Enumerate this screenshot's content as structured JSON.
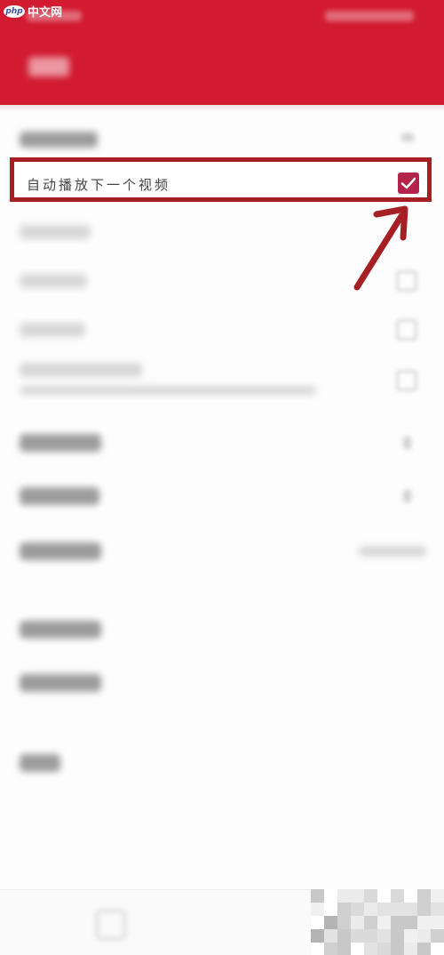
{
  "watermark": {
    "logo": "php",
    "site": "中文网"
  },
  "header": {
    "color": "#d21a30"
  },
  "autoplay_row": {
    "label": "自动播放下一个视频",
    "checked": true,
    "checkbox_color": "#b3234a",
    "highlight_color": "#a51f24"
  },
  "annotation": {
    "arrow_icon": "red-arrow-pointing-up"
  }
}
